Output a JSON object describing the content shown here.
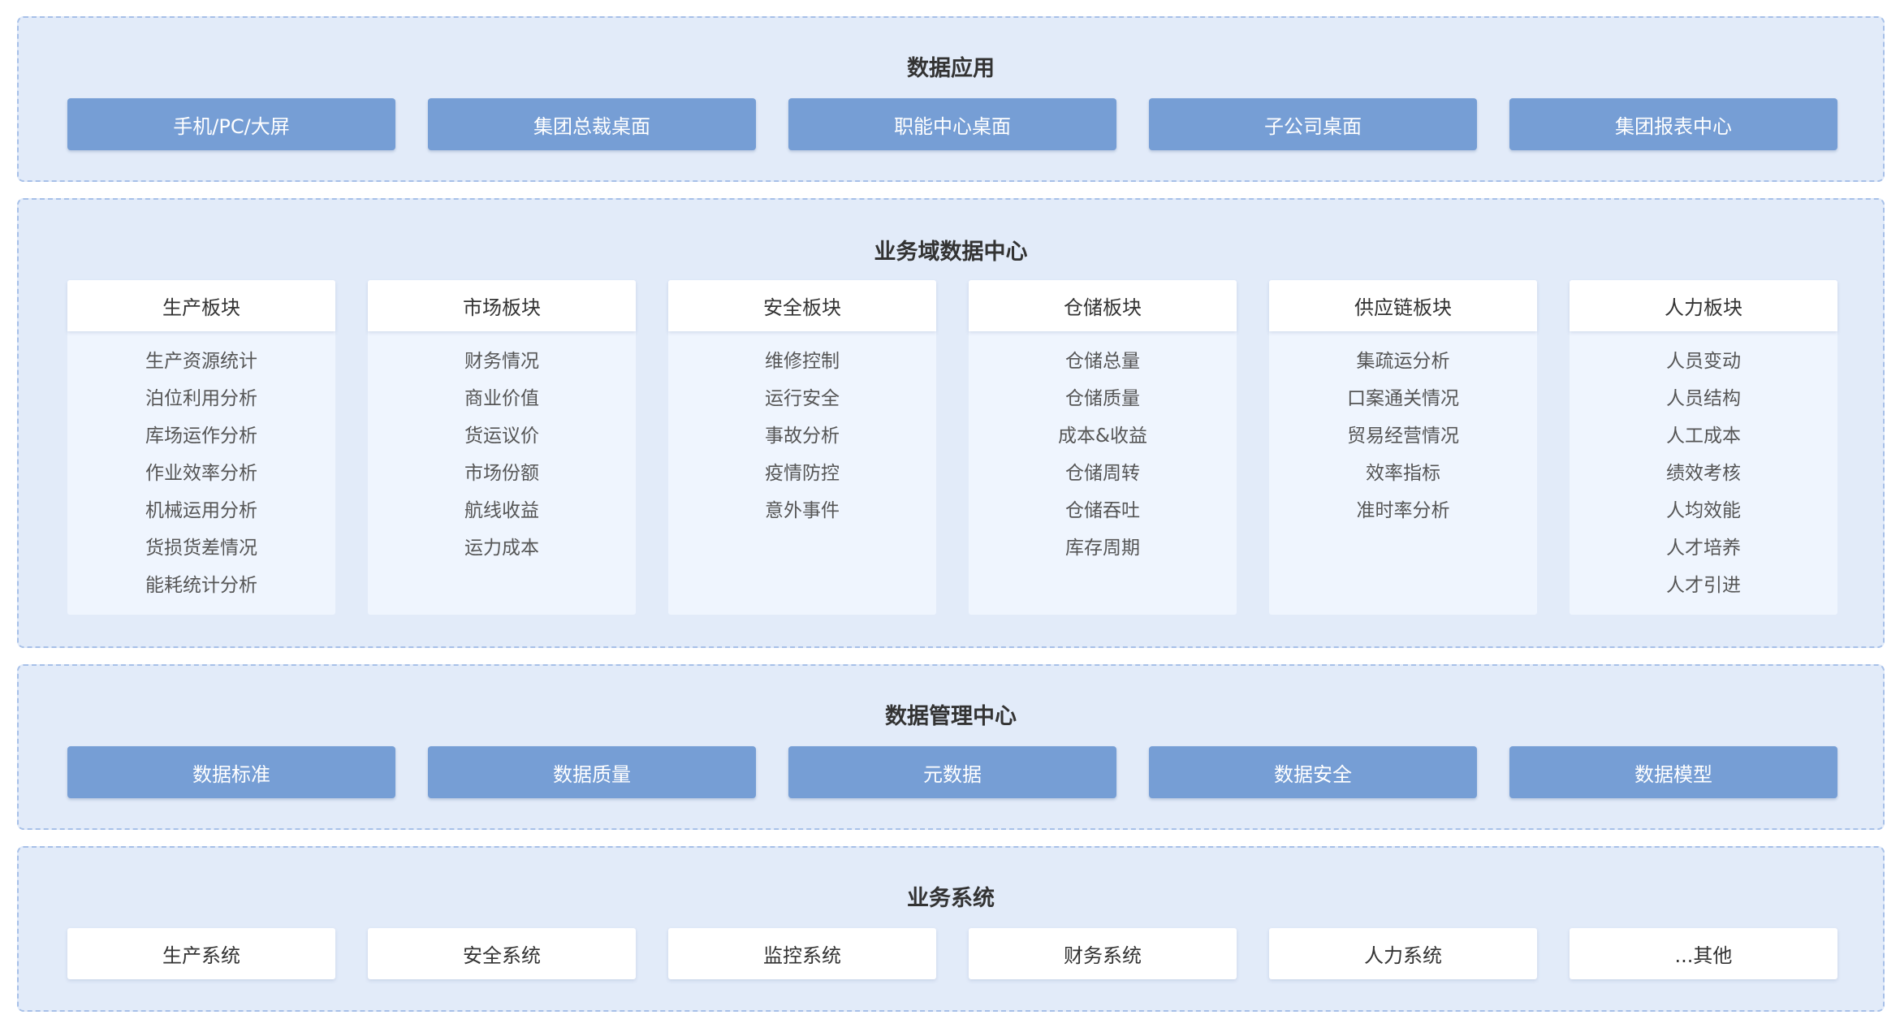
{
  "app": {
    "title": "数据应用",
    "items": [
      "手机/PC/大屏",
      "集团总裁桌面",
      "职能中心桌面",
      "子公司桌面",
      "集团报表中心"
    ]
  },
  "domain": {
    "title": "业务域数据中心",
    "columns": [
      {
        "label": "生产板块",
        "items": [
          "生产资源统计",
          "泊位利用分析",
          "库场运作分析",
          "作业效率分析",
          "机械运用分析",
          "货损货差情况",
          "能耗统计分析"
        ]
      },
      {
        "label": "市场板块",
        "items": [
          "财务情况",
          "商业价值",
          "货运议价",
          "市场份额",
          "航线收益",
          "运力成本"
        ]
      },
      {
        "label": "安全板块",
        "items": [
          "维修控制",
          "运行安全",
          "事故分析",
          "疫情防控",
          "意外事件"
        ]
      },
      {
        "label": "仓储板块",
        "items": [
          "仓储总量",
          "仓储质量",
          "成本&收益",
          "仓储周转",
          "仓储吞吐",
          "库存周期"
        ]
      },
      {
        "label": "供应链板块",
        "items": [
          "集疏运分析",
          "口案通关情况",
          "贸易经营情况",
          "效率指标",
          "准时率分析"
        ]
      },
      {
        "label": "人力板块",
        "items": [
          "人员变动",
          "人员结构",
          "人工成本",
          "绩效考核",
          "人均效能",
          "人才培养",
          "人才引进"
        ]
      }
    ]
  },
  "mgmt": {
    "title": "数据管理中心",
    "items": [
      "数据标准",
      "数据质量",
      "元数据",
      "数据安全",
      "数据模型"
    ]
  },
  "biz": {
    "title": "业务系统",
    "items": [
      "生产系统",
      "安全系统",
      "监控系统",
      "财务系统",
      "人力系统",
      "...其他"
    ]
  }
}
